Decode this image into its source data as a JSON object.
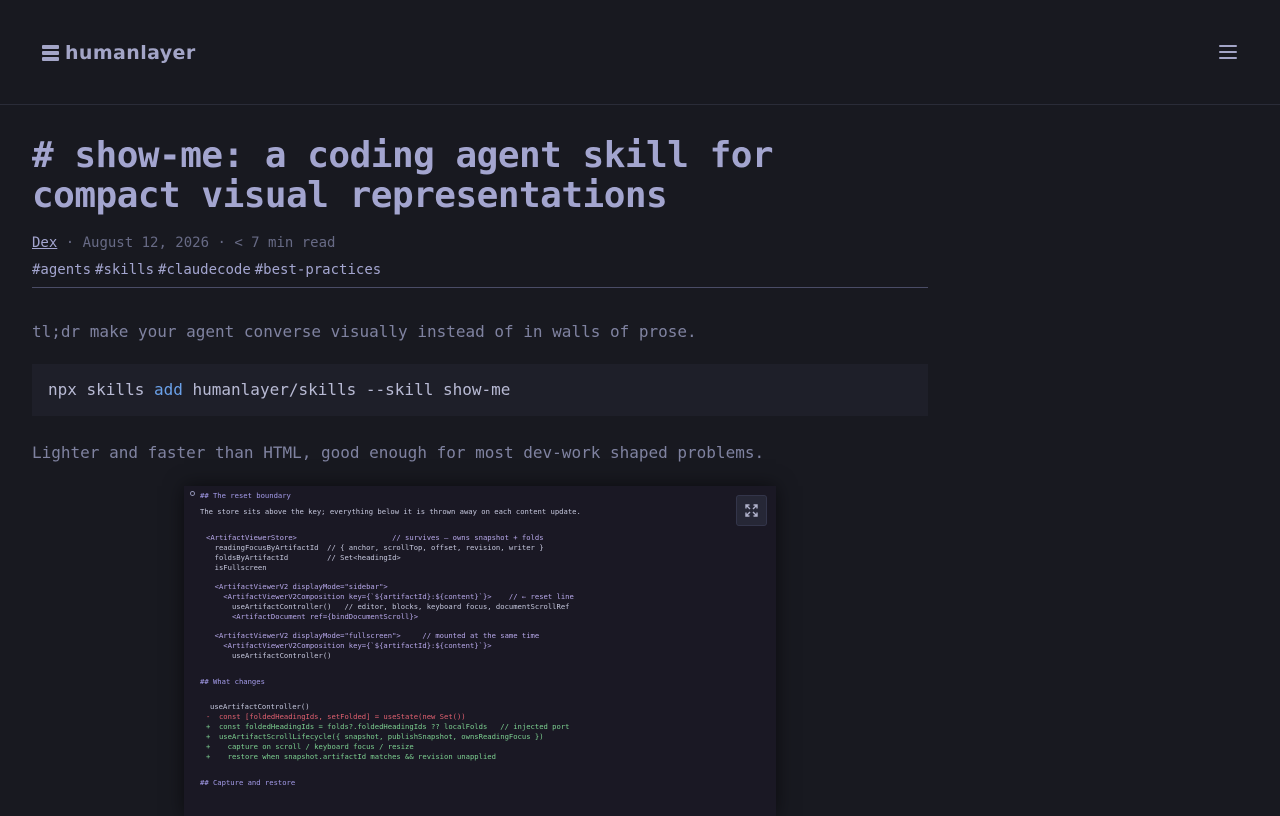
{
  "brand": {
    "name": "humanlayer"
  },
  "header": {
    "menu_icon": "hamburger-menu-icon"
  },
  "article": {
    "title": "# show-me: a coding agent skill for compact visual representations",
    "author": "Dex",
    "date": "August 12, 2026",
    "read_time": "< 7 min read",
    "tags": [
      "#agents",
      "#skills",
      "#claudecode",
      "#best-practices"
    ],
    "tldr": "tl;dr make your agent converse visually instead of in walls of prose.",
    "install_command": {
      "prefix": "npx skills ",
      "keyword": "add",
      "suffix": " humanlayer/skills --skill show-me"
    },
    "lighter": "Lighter and faster than HTML, good enough for most dev-work shaped problems."
  },
  "screenshot": {
    "expand_icon": "expand-icon",
    "lines": [
      "## The reset boundary",
      "The store sits above the key; everything below it is thrown away on each content update.",
      "<ArtifactViewerStore>                      // survives — owns snapshot + folds",
      "  readingFocusByArtifactId  // { anchor, scrollTop, offset, revision, writer }",
      "  foldsByArtifactId         // Set<headingId>",
      "  isFullscreen",
      "  <ArtifactViewerV2 displayMode=\"sidebar\">",
      "    <ArtifactViewerV2Composition key={`${artifactId}:${content}`}>    // ← reset line",
      "      useArtifactController()   // editor, blocks, keyboard focus, documentScrollRef",
      "      <ArtifactDocument ref={bindDocumentScroll}>",
      "  <ArtifactViewerV2 displayMode=\"fullscreen\">     // mounted at the same time",
      "    <ArtifactViewerV2Composition key={`${artifactId}:${content}`}>",
      "      useArtifactController()",
      "## What changes",
      "useArtifactController()",
      "-  const [foldedHeadingIds, setFolded] = useState(new Set())",
      "+  const foldedHeadingIds = folds?.foldedHeadingIds ?? localFolds   // injected port",
      "+  useArtifactScrollLifecycle({ snapshot, publishSnapshot, ownsReadingFocus })",
      "+    capture on scroll / keyboard focus / resize",
      "+    restore when snapshot.artifactId matches && revision unapplied",
      "## Capture and restore"
    ]
  }
}
